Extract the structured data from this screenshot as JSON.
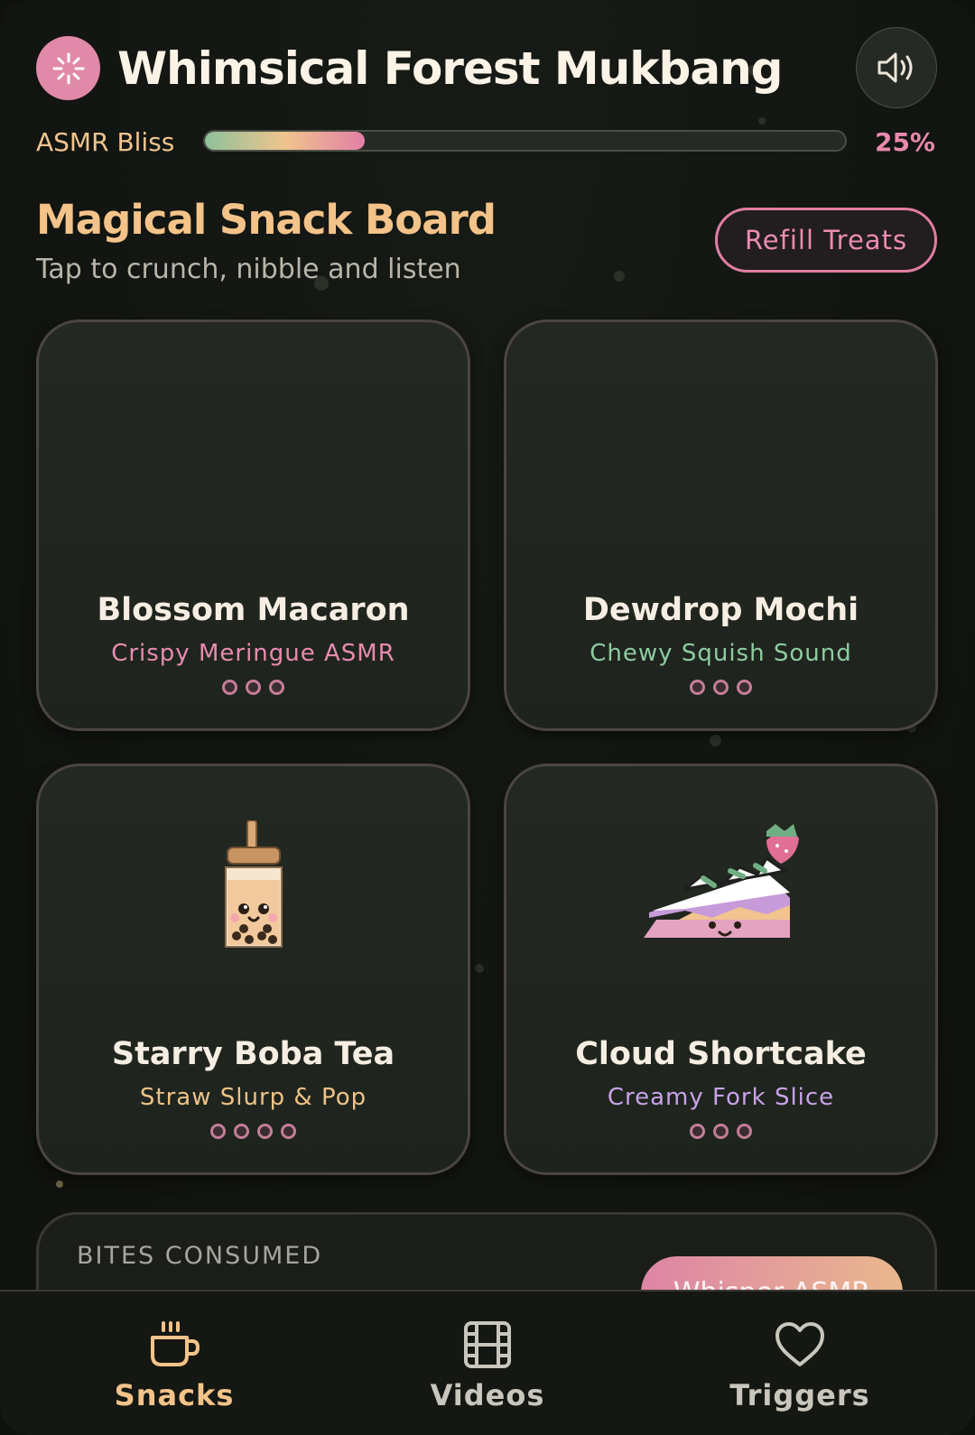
{
  "header": {
    "title": "Whimsical Forest Mukbang",
    "logo_icon": "sparkle-icon",
    "sound_icon": "speaker-icon"
  },
  "bliss": {
    "label": "ASMR Bliss",
    "percent_text": "25%",
    "progress": 0.25
  },
  "section": {
    "title": "Magical Snack Board",
    "subtitle": "Tap to crunch, nibble and listen",
    "refill_label": "Refill Treats"
  },
  "snacks": [
    {
      "name": "Blossom Macaron",
      "sound": "Crispy Meringue ASMR",
      "sound_color": "#e88bb0",
      "pips": 3,
      "art": ""
    },
    {
      "name": "Dewdrop Mochi",
      "sound": "Chewy Squish Sound",
      "sound_color": "#8ecba1",
      "pips": 3,
      "art": ""
    },
    {
      "name": "Starry Boba Tea",
      "sound": "Straw Slurp & Pop",
      "sound_color": "#efc286",
      "pips": 4,
      "art": "boba-tea-icon"
    },
    {
      "name": "Cloud Shortcake",
      "sound": "Creamy Fork Slice",
      "sound_color": "#c8a2e8",
      "pips": 3,
      "art": "shortcake-icon"
    }
  ],
  "stats": {
    "label": "BITES CONSUMED",
    "whisper_label": "Whisper ASMR"
  },
  "nav": {
    "items": [
      {
        "label": "Snacks",
        "icon": "cup-icon",
        "active": true,
        "color": "#f4c389"
      },
      {
        "label": "Videos",
        "icon": "film-icon",
        "active": false,
        "color": "#c9c6bd"
      },
      {
        "label": "Triggers",
        "icon": "heart-icon",
        "active": false,
        "color": "#c9c6bd"
      }
    ]
  },
  "colors": {
    "accent_pink": "#e189a8",
    "accent_gold": "#f4c389",
    "background": "#121511"
  }
}
